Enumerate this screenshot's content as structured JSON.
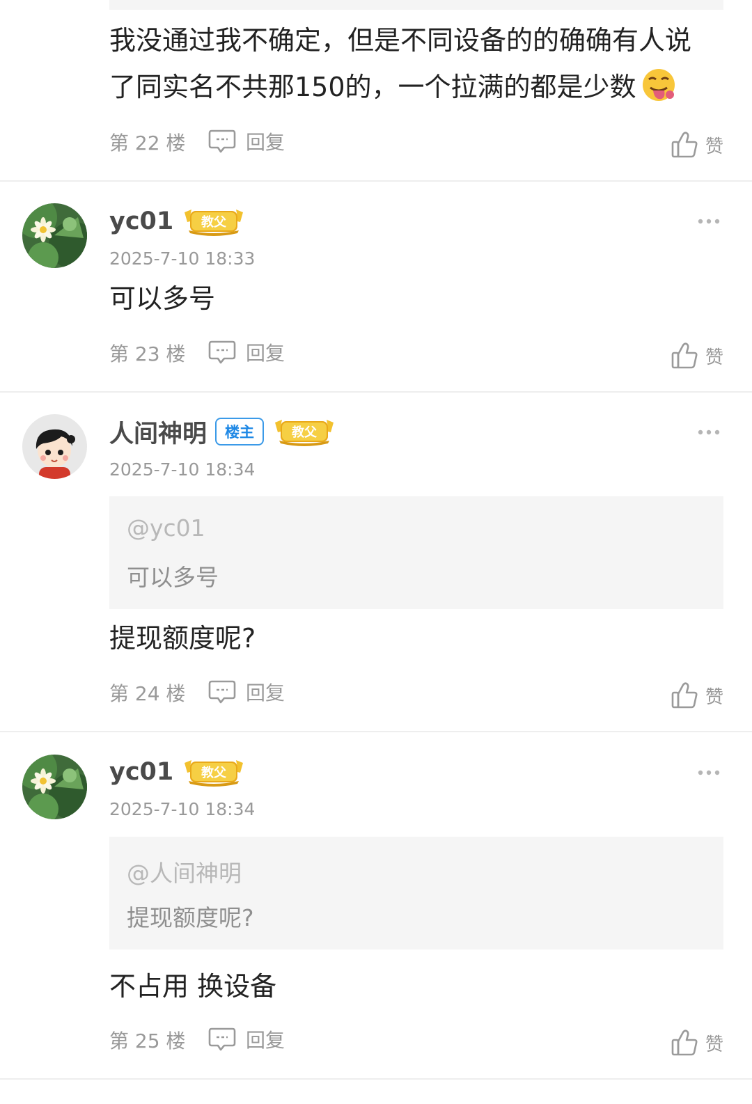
{
  "colors": {
    "accent_blue": "#1e88e5",
    "muted": "#999999",
    "quote_bg": "#f5f5f5",
    "badge_gold": "#f2c12e"
  },
  "icons": {
    "reply": "comment-bubble-icon",
    "like": "thumb-up-icon",
    "more": "more-dots-icon",
    "emoji": "tongue-out-emoji"
  },
  "labels": {
    "reply": "回复",
    "like": "赞",
    "owner_badge": "楼主",
    "title_badge": "教父"
  },
  "posts": [
    {
      "content_line1": "我没通过我不确定，但是不同设备的的确确有人说",
      "content_line2": "了同实名不共那150的，一个拉满的都是少数",
      "floor": "第 22 楼"
    },
    {
      "username": "yc01",
      "timestamp": "2025-7-10 18:33",
      "content": "可以多号",
      "floor": "第 23 楼"
    },
    {
      "username": "人间神明",
      "timestamp": "2025-7-10 18:34",
      "quote_at": "@yc01",
      "quote_text": "可以多号",
      "content": "提现额度呢?",
      "floor": "第 24 楼"
    },
    {
      "username": "yc01",
      "timestamp": "2025-7-10 18:34",
      "quote_at": "@人间神明",
      "quote_text": "提现额度呢?",
      "content": "不占用 换设备",
      "floor": "第 25 楼"
    }
  ]
}
